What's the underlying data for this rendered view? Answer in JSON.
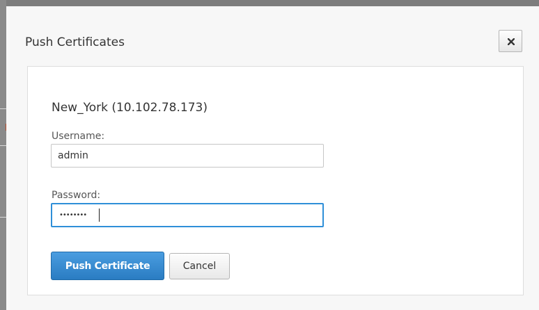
{
  "dialog": {
    "title": "Push Certificates",
    "close_icon": "close-x-icon"
  },
  "form": {
    "appliance": "New_York (10.102.78.173)",
    "username": {
      "label": "Username:",
      "value": "admin"
    },
    "password": {
      "label": "Password:",
      "masked_value": "••••••••"
    }
  },
  "actions": {
    "push_label": "Push Certificate",
    "cancel_label": "Cancel"
  },
  "colors": {
    "primary_button": "#2a7cc2",
    "focus_border": "#2f8fd8"
  }
}
